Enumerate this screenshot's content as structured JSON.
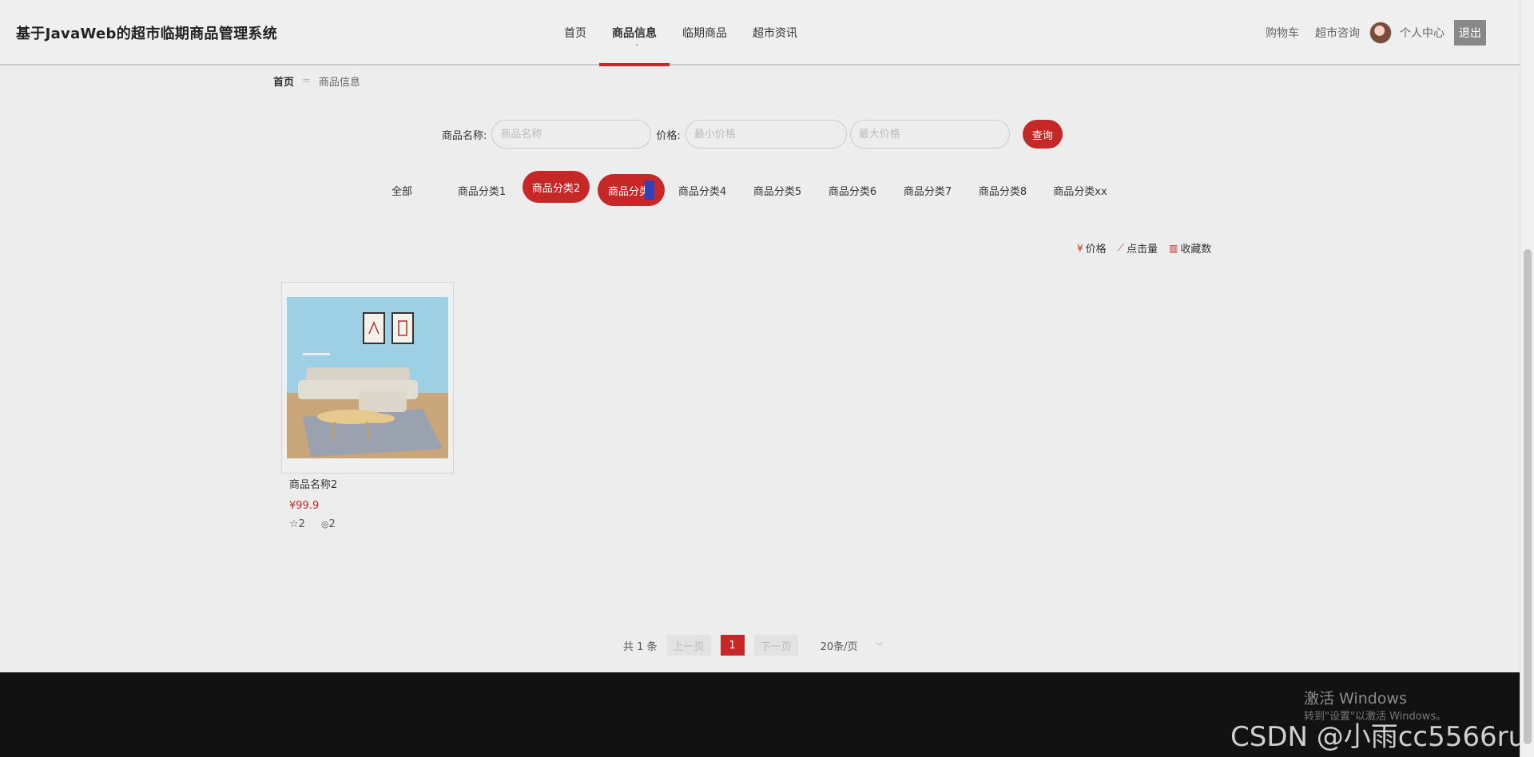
{
  "header": {
    "site_title": "基于JavaWeb的超市临期商品管理系统",
    "nav": [
      {
        "label": "首页"
      },
      {
        "label": "商品信息",
        "active": true
      },
      {
        "label": "临期商品"
      },
      {
        "label": "超市资讯"
      }
    ],
    "nav_mark": "ˊ",
    "right": {
      "cart": "购物车",
      "consult": "超市咨询",
      "profile": "个人中心",
      "logout": "退出"
    }
  },
  "breadcrumb": {
    "home": "首页",
    "separator": "=",
    "current": "商品信息"
  },
  "search": {
    "name_label": "商品名称:",
    "name_placeholder": "商品名称",
    "price_label": "价格:",
    "min_placeholder": "最小价格",
    "max_placeholder": "最大价格",
    "button": "查询"
  },
  "categories": [
    {
      "label": "全部"
    },
    {
      "label": "商品分类1"
    },
    {
      "label": "商品分类2",
      "active": true
    },
    {
      "label": "商品分类",
      "active": true,
      "hovered": true
    },
    {
      "label": "商品分类4"
    },
    {
      "label": "商品分类5"
    },
    {
      "label": "商品分类6"
    },
    {
      "label": "商品分类7"
    },
    {
      "label": "商品分类8"
    },
    {
      "label": "商品分类xx"
    }
  ],
  "sort": [
    {
      "icon": "yen-icon",
      "glyph": "¥",
      "label": "价格"
    },
    {
      "icon": "trend-icon",
      "glyph": "⟋",
      "label": "点击量"
    },
    {
      "icon": "bar-chart-icon",
      "glyph": "▥",
      "label": "收藏数"
    }
  ],
  "product": {
    "name": "商品名称2",
    "price": "¥99.9",
    "favorites": "2",
    "views": "2"
  },
  "pagination": {
    "total": "共 1 条",
    "prev": "上一页",
    "current_page": "1",
    "next": "下一页",
    "page_size": "20条/页"
  },
  "footer": {
    "activate_title": "激活 Windows",
    "activate_sub": "转到\"设置\"以激活 Windows。",
    "watermark": "CSDN @小雨cc5566ru"
  },
  "colors": {
    "accent": "#c62828",
    "footer_bg": "#131213",
    "page_bg": "#ededed"
  }
}
